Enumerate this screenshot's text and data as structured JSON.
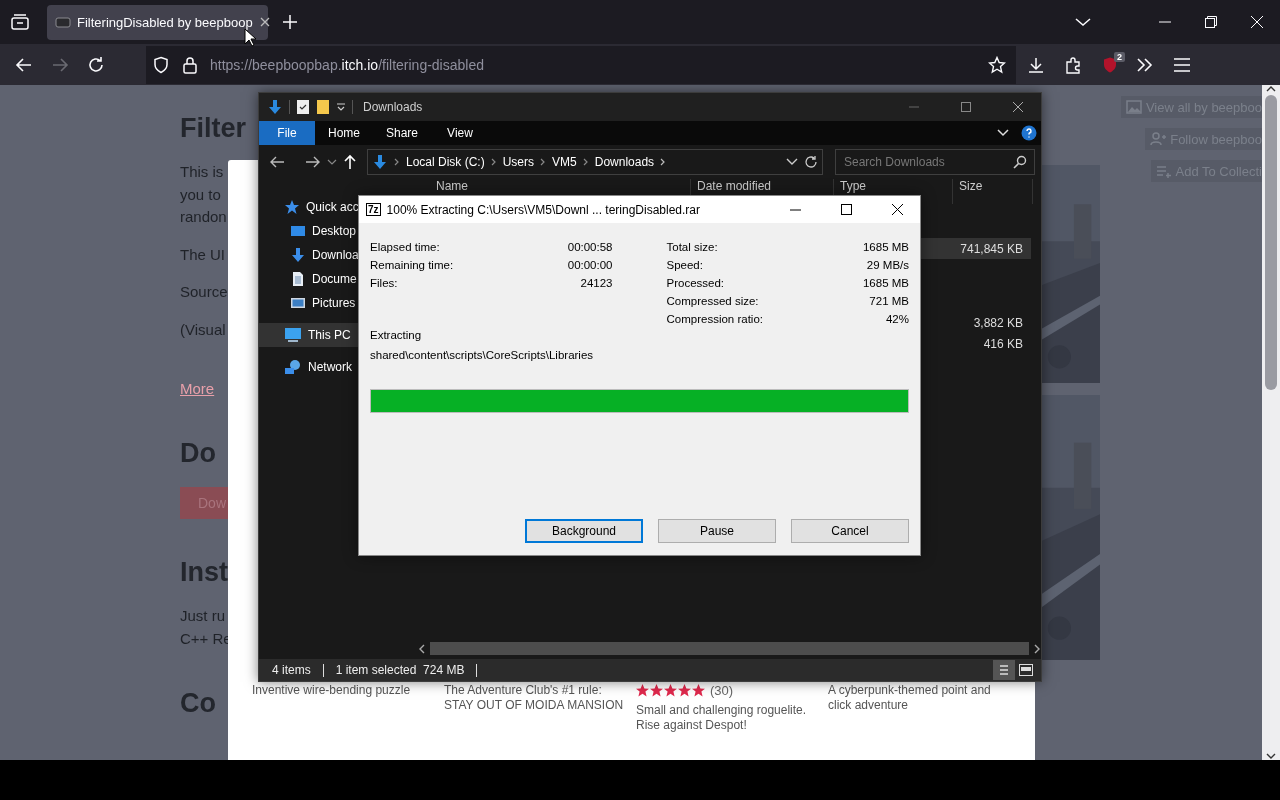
{
  "browser": {
    "tab": {
      "title": "FilteringDisabled by beepboop",
      "selected": true
    },
    "url": {
      "prefix": "https://beepboopbap.",
      "domain": "itch.io",
      "path": "/filtering-disabled"
    },
    "extension_badge": "2"
  },
  "page": {
    "left_column": [
      {
        "kind": "heading",
        "text": "Filter"
      },
      {
        "kind": "paragraph",
        "lines": [
          "This is",
          "you to",
          "randon"
        ]
      },
      {
        "kind": "paragraph",
        "lines": [
          "The UI"
        ]
      },
      {
        "kind": "paragraph",
        "lines": [
          "Source"
        ]
      },
      {
        "kind": "paragraph",
        "lines": [
          "(Visual"
        ]
      },
      {
        "kind": "link",
        "text": "More"
      },
      {
        "kind": "heading",
        "text": "Do"
      },
      {
        "kind": "button",
        "text": "Dow"
      },
      {
        "kind": "heading",
        "text": "Inst"
      },
      {
        "kind": "paragraph",
        "lines": [
          "Just ru",
          "C++ Re"
        ]
      },
      {
        "kind": "heading",
        "text": "Co"
      }
    ],
    "right_buttons": [
      {
        "label": "View all by beepboo",
        "kind": "gallery"
      },
      {
        "label": "Follow beepboo",
        "kind": "follow"
      },
      {
        "label": "Add To Collecti",
        "kind": "collection"
      }
    ],
    "cards": [
      {
        "description": "Inventive wire-bending puzzle"
      },
      {
        "description": "The Adventure Club's #1 rule:\nSTAY OUT OF MOIDA MANSION"
      },
      {
        "stars": 5,
        "rating_count": "(30)",
        "description": "Small and challenging roguelite.\nRise against Despot!"
      },
      {
        "description": "A cyberpunk-themed point and\nclick adventure"
      }
    ]
  },
  "explorer": {
    "title": "Downloads",
    "ribbon_tabs": [
      {
        "label": "File",
        "selected": true
      },
      {
        "label": "Home",
        "selected": false
      },
      {
        "label": "Share",
        "selected": false
      },
      {
        "label": "View",
        "selected": false
      }
    ],
    "breadcrumbs": [
      "Local Disk (C:)",
      "Users",
      "VM5",
      "Downloads"
    ],
    "search": {
      "placeholder": "Search Downloads"
    },
    "nav_items": [
      {
        "label": "Quick acc",
        "kind": "star",
        "selected": false,
        "children": [
          {
            "label": "Desktop",
            "kind": "desktop",
            "selected": false
          },
          {
            "label": "Downloa",
            "kind": "download",
            "selected": false
          },
          {
            "label": "Docume",
            "kind": "document",
            "selected": false
          },
          {
            "label": "Pictures",
            "kind": "pictures",
            "selected": false
          }
        ]
      },
      {
        "label": "This PC",
        "kind": "pc",
        "selected": true
      },
      {
        "label": "Network",
        "kind": "network",
        "selected": false
      }
    ],
    "columns": [
      "Name",
      "Date modified",
      "Type",
      "Size"
    ],
    "file_groups": [
      [
        {
          "size": "741,845 KB",
          "selected": true
        }
      ],
      [
        {
          "size": "3,882 KB",
          "selected": false
        },
        {
          "size": "416 KB",
          "selected": false
        }
      ]
    ],
    "status": {
      "items": "4 items",
      "selection": "1 item selected  724 MB"
    }
  },
  "dialog": {
    "app_icon": "7z",
    "title": "100% Extracting C:\\Users\\VM5\\Downl ... teringDisabled.rar",
    "left_stats": [
      {
        "label": "Elapsed time:",
        "value": "00:00:58"
      },
      {
        "label": "Remaining time:",
        "value": "00:00:00"
      },
      {
        "label": "Files:",
        "value": "24123"
      }
    ],
    "right_stats": [
      {
        "label": "Total size:",
        "value": "1685 MB"
      },
      {
        "label": "Speed:",
        "value": "29 MB/s"
      },
      {
        "label": "Processed:",
        "value": "1685 MB"
      },
      {
        "label": "Compressed size:",
        "value": "721 MB"
      },
      {
        "label": "Compression ratio:",
        "value": "42%"
      }
    ],
    "status_label": "Extracting",
    "current_path": "shared\\content\\scripts\\CoreScripts\\Libraries",
    "progress": {
      "level": 1
    },
    "buttons": [
      {
        "label": "Background",
        "focused": true
      },
      {
        "label": "Pause",
        "focused": false
      },
      {
        "label": "Cancel",
        "focused": false
      }
    ]
  }
}
